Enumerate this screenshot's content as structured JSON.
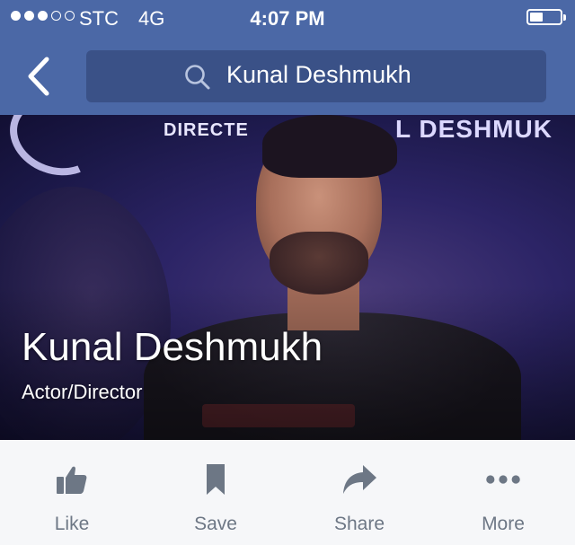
{
  "status_bar": {
    "carrier": "STC",
    "network": "4G",
    "time": "4:07 PM",
    "signal_bars_filled": 3,
    "signal_bars_total": 5,
    "battery_level": 0.3
  },
  "nav": {
    "back_icon": "chevron-left-icon",
    "search_icon": "search-icon",
    "search_text": "Kunal Deshmukh"
  },
  "cover": {
    "banner_left": "DIRECTE",
    "banner_right": "L DESHMUK"
  },
  "profile": {
    "name": "Kunal Deshmukh",
    "category": "Actor/Director"
  },
  "actions": [
    {
      "label": "Like",
      "icon": "thumbs-up-icon"
    },
    {
      "label": "Save",
      "icon": "bookmark-icon"
    },
    {
      "label": "Share",
      "icon": "share-arrow-icon"
    },
    {
      "label": "More",
      "icon": "more-dots-icon"
    }
  ],
  "colors": {
    "header_bg": "#4b68a6",
    "search_bg": "#3a5187",
    "action_bar_bg": "#f6f7f9",
    "action_icon": "#6d7785"
  }
}
